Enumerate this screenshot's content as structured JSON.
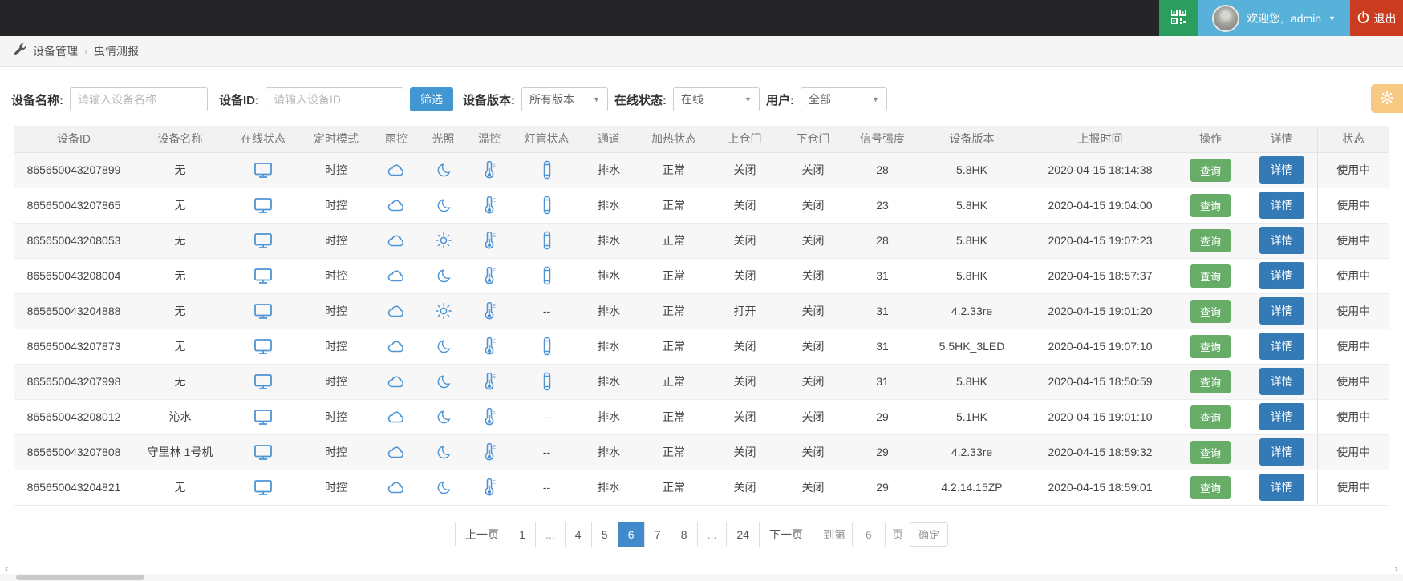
{
  "topbar": {
    "welcome_text": "欢迎您,",
    "username": "admin",
    "logout_label": "退出"
  },
  "breadcrumb": {
    "items": [
      "设备管理",
      "虫情测报"
    ],
    "separator": "›"
  },
  "filters": {
    "device_name_label": "设备名称:",
    "device_name_placeholder": "请输入设备名称",
    "device_id_label": "设备ID:",
    "device_id_placeholder": "请输入设备ID",
    "filter_button_label": "筛选",
    "version_label": "设备版本:",
    "version_value": "所有版本",
    "online_label": "在线状态:",
    "online_value": "在线",
    "user_label": "用户:",
    "user_value": "全部"
  },
  "icons": {
    "qr": "qr-code-icon",
    "power": "power-icon",
    "wrench": "wrench-icon",
    "gear": "gear-icon",
    "monitor": "monitor-icon",
    "cloud": "cloud-icon",
    "moon": "moon-icon",
    "sun": "sun-icon",
    "thermometer": "thermometer-icon",
    "tube": "lamp-tube-icon"
  },
  "colors": {
    "topbar_bg": "#252528",
    "green": "#2a9d5f",
    "user_blue": "#58b1d8",
    "logout_red": "#cb3b20",
    "filter_blue": "#4296d2",
    "query_green": "#67ad68",
    "detail_blue": "#337ab7",
    "active_page_blue": "#428bca",
    "icon_blue": "#4f94d4",
    "gear_orange": "#f8c983"
  },
  "table": {
    "columns": [
      "设备ID",
      "设备名称",
      "在线状态",
      "定时模式",
      "雨控",
      "光照",
      "温控",
      "灯管状态",
      "通道",
      "加热状态",
      "上仓门",
      "下仓门",
      "信号强度",
      "设备版本",
      "上报时间",
      "操作",
      "详情",
      "状态"
    ],
    "query_button_label": "查询",
    "detail_button_label": "详情",
    "rows": [
      {
        "device_id": "865650043207899",
        "name": "无",
        "timer_mode": "时控",
        "light": "moon",
        "lamp": "tube",
        "channel": "排水",
        "heat": "正常",
        "upper_door": "关闭",
        "lower_door": "关闭",
        "signal": "28",
        "version": "5.8HK",
        "report_time": "2020-04-15 18:14:38",
        "status": "使用中"
      },
      {
        "device_id": "865650043207865",
        "name": "无",
        "timer_mode": "时控",
        "light": "moon",
        "lamp": "tube",
        "channel": "排水",
        "heat": "正常",
        "upper_door": "关闭",
        "lower_door": "关闭",
        "signal": "23",
        "version": "5.8HK",
        "report_time": "2020-04-15 19:04:00",
        "status": "使用中"
      },
      {
        "device_id": "865650043208053",
        "name": "无",
        "timer_mode": "时控",
        "light": "sun",
        "lamp": "tube",
        "channel": "排水",
        "heat": "正常",
        "upper_door": "关闭",
        "lower_door": "关闭",
        "signal": "28",
        "version": "5.8HK",
        "report_time": "2020-04-15 19:07:23",
        "status": "使用中"
      },
      {
        "device_id": "865650043208004",
        "name": "无",
        "timer_mode": "时控",
        "light": "moon",
        "lamp": "tube",
        "channel": "排水",
        "heat": "正常",
        "upper_door": "关闭",
        "lower_door": "关闭",
        "signal": "31",
        "version": "5.8HK",
        "report_time": "2020-04-15 18:57:37",
        "status": "使用中"
      },
      {
        "device_id": "865650043204888",
        "name": "无",
        "timer_mode": "时控",
        "light": "sun",
        "lamp": "--",
        "channel": "排水",
        "heat": "正常",
        "upper_door": "打开",
        "lower_door": "关闭",
        "signal": "31",
        "version": "4.2.33re",
        "report_time": "2020-04-15 19:01:20",
        "status": "使用中"
      },
      {
        "device_id": "865650043207873",
        "name": "无",
        "timer_mode": "时控",
        "light": "moon",
        "lamp": "tube",
        "channel": "排水",
        "heat": "正常",
        "upper_door": "关闭",
        "lower_door": "关闭",
        "signal": "31",
        "version": "5.5HK_3LED",
        "report_time": "2020-04-15 19:07:10",
        "status": "使用中"
      },
      {
        "device_id": "865650043207998",
        "name": "无",
        "timer_mode": "时控",
        "light": "moon",
        "lamp": "tube",
        "channel": "排水",
        "heat": "正常",
        "upper_door": "关闭",
        "lower_door": "关闭",
        "signal": "31",
        "version": "5.8HK",
        "report_time": "2020-04-15 18:50:59",
        "status": "使用中"
      },
      {
        "device_id": "865650043208012",
        "name": "沁水",
        "timer_mode": "时控",
        "light": "moon",
        "lamp": "--",
        "channel": "排水",
        "heat": "正常",
        "upper_door": "关闭",
        "lower_door": "关闭",
        "signal": "29",
        "version": "5.1HK",
        "report_time": "2020-04-15 19:01:10",
        "status": "使用中"
      },
      {
        "device_id": "865650043207808",
        "name": "守里林 1号机",
        "timer_mode": "时控",
        "light": "moon",
        "lamp": "--",
        "channel": "排水",
        "heat": "正常",
        "upper_door": "关闭",
        "lower_door": "关闭",
        "signal": "29",
        "version": "4.2.33re",
        "report_time": "2020-04-15 18:59:32",
        "status": "使用中"
      },
      {
        "device_id": "865650043204821",
        "name": "无",
        "timer_mode": "时控",
        "light": "moon",
        "lamp": "--",
        "channel": "排水",
        "heat": "正常",
        "upper_door": "关闭",
        "lower_door": "关闭",
        "signal": "29",
        "version": "4.2.14.15ZP",
        "report_time": "2020-04-15 18:59:01",
        "status": "使用中"
      }
    ]
  },
  "pagination": {
    "items": [
      "上一页",
      "1",
      "...",
      "4",
      "5",
      "6",
      "7",
      "8",
      "...",
      "24",
      "下一页"
    ],
    "active": "6",
    "goto_prefix": "到第",
    "goto_value": "6",
    "goto_suffix": "页",
    "confirm_label": "确定"
  }
}
